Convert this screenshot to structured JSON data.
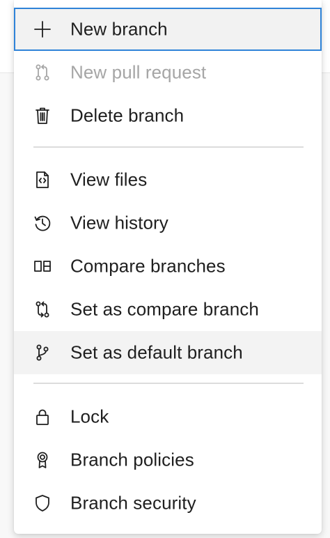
{
  "menu": {
    "items": [
      {
        "label": "New branch",
        "icon": "plus-icon",
        "state": "focused"
      },
      {
        "label": "New pull request",
        "icon": "pull-request-icon",
        "state": "disabled"
      },
      {
        "label": "Delete branch",
        "icon": "trash-icon",
        "state": "normal"
      },
      {
        "label": "View files",
        "icon": "code-file-icon",
        "state": "normal"
      },
      {
        "label": "View history",
        "icon": "history-icon",
        "state": "normal"
      },
      {
        "label": "Compare branches",
        "icon": "compare-icon",
        "state": "normal"
      },
      {
        "label": "Set as compare branch",
        "icon": "compare-branch-icon",
        "state": "normal"
      },
      {
        "label": "Set as default branch",
        "icon": "branch-icon",
        "state": "hovered"
      },
      {
        "label": "Lock",
        "icon": "lock-icon",
        "state": "normal"
      },
      {
        "label": "Branch policies",
        "icon": "badge-icon",
        "state": "normal"
      },
      {
        "label": "Branch security",
        "icon": "shield-icon",
        "state": "normal"
      }
    ]
  },
  "colors": {
    "focus_border": "#2f83d8",
    "text": "#1f1f1f",
    "disabled_text": "#a6a6a6",
    "hover_bg": "#f3f3f3",
    "divider": "#dcdcdc"
  }
}
